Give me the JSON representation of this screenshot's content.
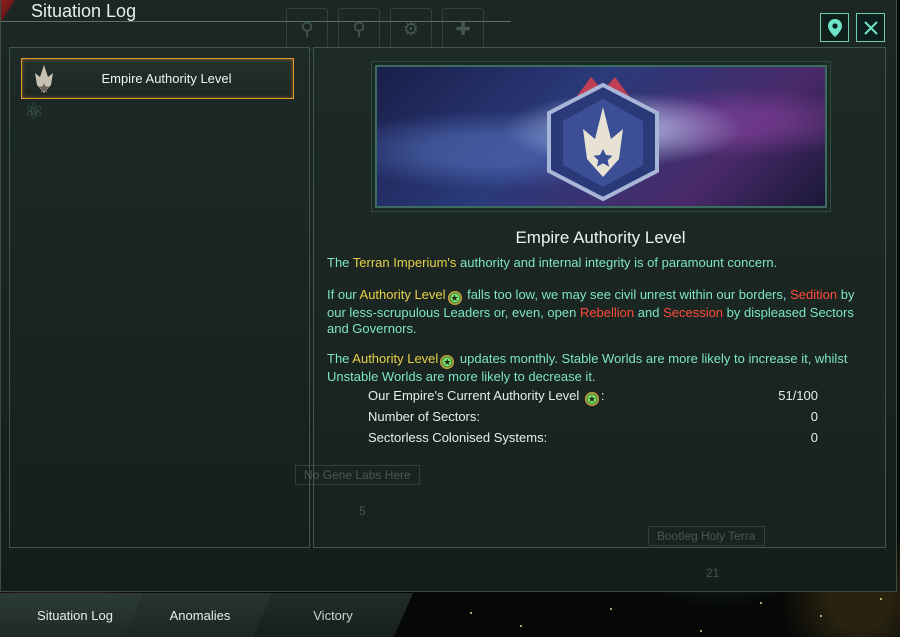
{
  "window": {
    "title": "Situation Log"
  },
  "header_buttons": {
    "locate_icon": "map-pin-icon",
    "close_icon": "close-icon"
  },
  "list": {
    "items": [
      {
        "label": "Empire Authority Level",
        "icon": "authority-emblem-icon",
        "selected": true
      }
    ]
  },
  "detail": {
    "title": "Empire Authority Level",
    "p1": {
      "a": "The ",
      "empire": "Terran Imperium's",
      "b": " authority and internal integrity is of paramount concern."
    },
    "p2": {
      "a": "If our ",
      "authority": "Authority Level",
      "b": " falls too low, we may see civil unrest within our borders, ",
      "sedition": "Sedition",
      "c": " by our less-scrupulous Leaders or, even, open ",
      "rebellion": "Rebellion",
      "d": " and ",
      "secession": "Secession",
      "e": " by displeased Sectors and Governors."
    },
    "p3": {
      "a": "The ",
      "authority": "Authority Level",
      "b": " updates monthly. Stable Worlds are more likely to increase it, whilst Unstable Worlds are more likely to decrease it."
    },
    "stats": [
      {
        "label": "Our Empire's Current Authority Level",
        "suffix": ":",
        "value": "51/100",
        "has_icon": true
      },
      {
        "label": "Number of Sectors:",
        "value": "0"
      },
      {
        "label": "Sectorless Colonised Systems:",
        "value": "0"
      }
    ]
  },
  "map_labels": {
    "gene_labs": "No Gene Labs Here",
    "holy_terra": "Bootleg Holy Terra",
    "num_5": "5",
    "num_21": "21"
  },
  "tabs": [
    {
      "label": "Situation Log",
      "active": true
    },
    {
      "label": "Anomalies",
      "active": false
    },
    {
      "label": "Victory",
      "active": false
    }
  ],
  "colors": {
    "accent_teal": "#7ee6c6",
    "highlight_yellow": "#e8d24a",
    "highlight_red": "#ff4a3a",
    "selection_orange": "#e59a2b"
  }
}
